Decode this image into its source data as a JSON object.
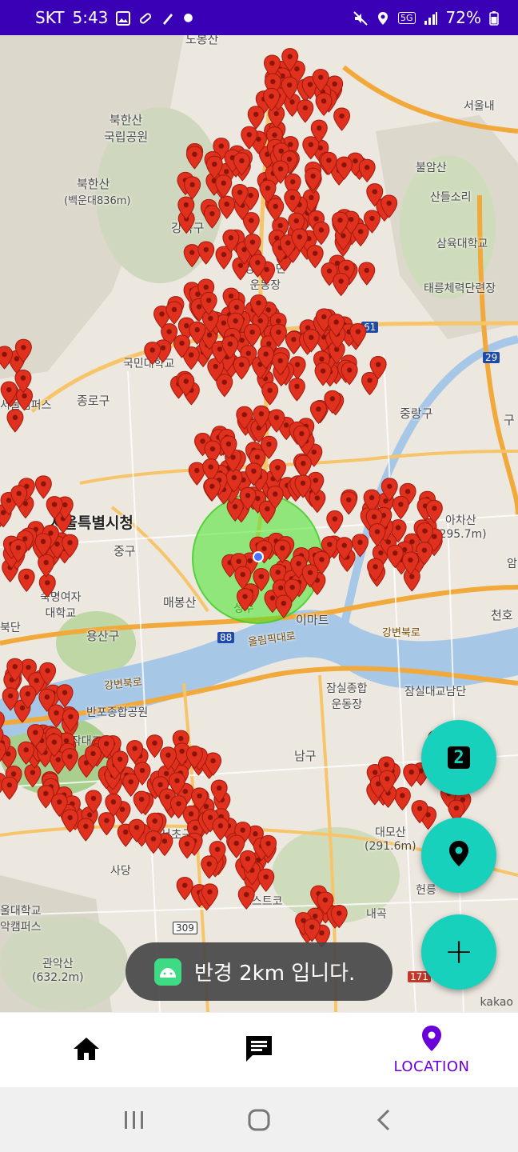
{
  "status": {
    "carrier": "SKT",
    "time": "5:43",
    "network": "5G",
    "battery": "72%"
  },
  "map": {
    "labels": {
      "dobongsan": "도봉산",
      "bukhansan_park": "북한산\n국립공원",
      "bukhansan": "북한산",
      "baegundae": "(백운대836m)",
      "gangbukgu": "강북구",
      "gangbuk_office": "강북구민\n운동장",
      "kookmin": "국민대학교",
      "jongno": "종로구",
      "seoul_city_hall": "서울특별시청",
      "junggu": "중구",
      "maebongsan": "매봉산",
      "yongsan": "용산구",
      "sookmyung": "숙명여자\n대학교",
      "seongsu": "성수",
      "emart": "이마트",
      "olympic": "올림픽대로",
      "gangbyeon": "강변북로",
      "jungnang": "중랑구",
      "achasan": "아차산\n(295.7m)",
      "cheonho": "천호",
      "jamsil_sports": "잠실종합\n운동장",
      "jamsil_bridge": "잠실대교남단",
      "banpo": "반포종합공원",
      "dongjak": "동작대교",
      "seocho": "서초구",
      "sadang": "사당",
      "daemosan": "대모산\n(291.6m)",
      "costco": "코스트코",
      "gwanaksan": "관악산\n(632.2m)",
      "seoulnae": "서울내",
      "bulamsan": "불암산",
      "sandle": "산들소리",
      "sahmyook": "삼육대학교",
      "taereung": "태릉체력단련장",
      "naegok": "내곡",
      "seoul_univ": "울대학교\n악캠퍼스",
      "hanyang": "서울캠퍼스",
      "bukdan": "북단",
      "gangnam": "남구",
      "hyeonneung": "헌릉",
      "gu": "구",
      "am": "암"
    },
    "roads": [
      "61",
      "29",
      "88",
      "309",
      "171"
    ],
    "attribution": "kakao"
  },
  "fabs": {
    "page_badge": "2",
    "add": "+"
  },
  "toast": {
    "message": "반경 2km 입니다."
  },
  "bottom_nav": {
    "home": "",
    "chat": "",
    "location": "LOCATION"
  },
  "colors": {
    "statusbar": "#3a00b5",
    "accent": "#6a00d8",
    "fab": "#18d1bd",
    "pin": "#e0301e",
    "radius": "#46e628"
  }
}
